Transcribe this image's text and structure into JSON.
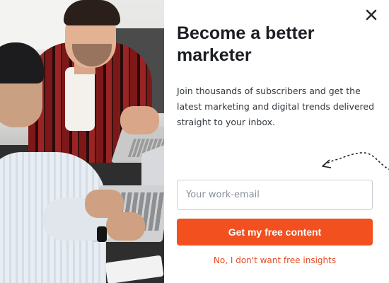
{
  "modal": {
    "title": "Become a better marketer",
    "description": "Join thousands of subscribers and get the latest marketing and digital trends delivered straight to your inbox.",
    "email_placeholder": "Your work-email",
    "email_value": "",
    "cta_label": "Get my free content",
    "decline_label": "No, I don't want free insights",
    "close_icon": "close-icon"
  },
  "colors": {
    "accent": "#f2501f",
    "decline_link": "#e34b22",
    "title": "#1c1e24",
    "text": "#333a40",
    "input_border": "#c9ced4"
  }
}
